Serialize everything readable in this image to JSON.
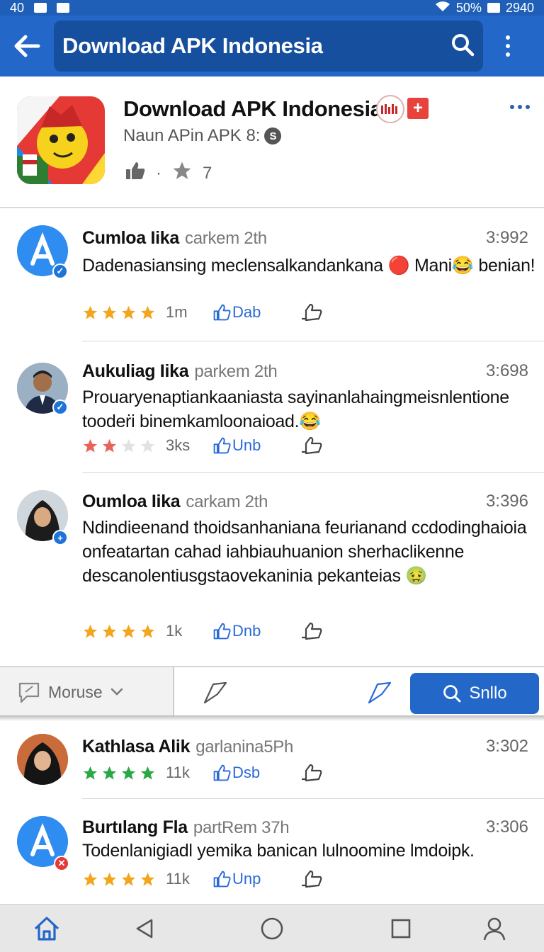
{
  "status_bar": {
    "left_text": "40",
    "battery": "50%",
    "time": "2940"
  },
  "app_bar": {
    "title": "Download APK Indonesia",
    "back_icon": "arrow-left-icon",
    "search_icon": "search-icon",
    "menu_icon": "more-vertical-icon"
  },
  "app": {
    "title": "Download APK Indonesia",
    "subtitle": "Naun APin APK 8:",
    "subtitle_badge": "S",
    "rating_value": "7",
    "plus_badge": "+"
  },
  "reviews": [
    {
      "name": "Cumloa Iika",
      "meta": "carkem 2th",
      "time": "3:992",
      "text": "Dadenasiansing meclensalkandankana 🔴 Mani😂 benian!",
      "stars": 4,
      "star_color": "#f3a51d",
      "count": "1m",
      "like_label": "Dab"
    },
    {
      "name": "Aukuliag Iika",
      "meta": "parkem 2th",
      "time": "3:698",
      "text": "Prouaryenaptiankaaniasta sayinanlahaingmeisnlentione toodeṙi binemkamloonaioad.😂",
      "stars": 2,
      "star_color": "#e8645a",
      "count": "3ks",
      "like_label": "Unb"
    },
    {
      "name": "Oumloa Iika",
      "meta": "carkam 2th",
      "time": "3:396",
      "text": "Ndindieenand thoidsanhaniana feurianand ccdodinghaioia onfeatartan cahad iahbiauhuanion sherhaclikenne descanolentiusgstaovekaninia pekanteias 🤢",
      "stars": 4,
      "star_color": "#f3a51d",
      "count": "1k",
      "like_label": "Dnb"
    },
    {
      "name": "Kathlasa Alik",
      "meta": "garlanina5Ph",
      "time": "3:302",
      "text": "",
      "stars": 4,
      "star_color": "#2aa846",
      "count": "11k",
      "like_label": "Dsb"
    },
    {
      "name": "Burtılang Fla",
      "meta": "partRem 37h",
      "time": "3:306",
      "text": "Todenlanigiadl yemika banican lulnoomine lmdoipk.",
      "stars": 4,
      "star_color": "#f3a51d",
      "count": "11k",
      "like_label": "Unp"
    }
  ],
  "toolbar": {
    "dropdown_label": "Moruse",
    "search_button": "Snllo"
  },
  "nav": [
    "home-icon",
    "back-triangle-icon",
    "home-circle-icon",
    "recents-square-icon",
    "profile-icon"
  ],
  "colors": {
    "primary": "#2367c9",
    "primary_dark": "#164f9e",
    "star_gold": "#f3a51d",
    "star_green": "#2aa846",
    "link_blue": "#2a6ad8"
  }
}
